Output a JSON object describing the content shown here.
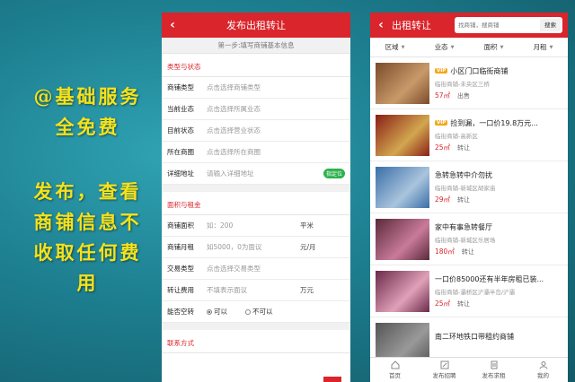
{
  "promo": {
    "lines": [
      "@基础服务",
      "全免费",
      "发布，查看",
      "商铺信息不",
      "收取任何费",
      "用"
    ]
  },
  "publish": {
    "title": "发布出租转让",
    "step": "第一步:填写商铺基本信息",
    "section1": "类型与状态",
    "fields1": [
      {
        "label": "商铺类型",
        "value": "点击选择商铺类型"
      },
      {
        "label": "当前业态",
        "value": "点击选择所属业态"
      },
      {
        "label": "目前状态",
        "value": "点击选择营业状态"
      },
      {
        "label": "所在商圈",
        "value": "点击选择所在商圈"
      },
      {
        "label": "详细地址",
        "value": "请输入详细地址"
      }
    ],
    "locate_label": "指定位",
    "section2": "面积与租金",
    "fields2": [
      {
        "label": "商铺面积",
        "value": "如：200",
        "unit": "平米"
      },
      {
        "label": "商铺月租",
        "value": "如5000，0为面议",
        "unit": "元/月"
      },
      {
        "label": "交易类型",
        "value": "点击选择交易类型",
        "unit": ""
      },
      {
        "label": "转让费用",
        "value": "不填表示面议",
        "unit": "万元"
      }
    ],
    "vacant_label": "能否空转",
    "vacant_yes": "可以",
    "vacant_no": "不可以",
    "section3": "联系方式"
  },
  "listing": {
    "title": "出租转让",
    "search_placeholder": "找商铺，搜商铺",
    "search_button": "搜索",
    "filters": [
      "区域",
      "业态",
      "面积",
      "月租"
    ],
    "items": [
      {
        "vip": true,
        "vip_label": "VIP",
        "title": "小区门口临街商铺",
        "location": "临街商铺-未央区三桥",
        "price": "57㎡",
        "type": "出售",
        "img": [
          "#7a4b2a",
          "#c89a6a"
        ]
      },
      {
        "vip": true,
        "vip_label": "VIP",
        "title": "捡到漏，一口价19.8万元...",
        "location": "临街商铺-高新区",
        "price": "25㎡",
        "type": "转让",
        "img": [
          "#8a1f16",
          "#d2a64f"
        ]
      },
      {
        "vip": false,
        "vip_label": "",
        "title": "急转急转中介勿扰",
        "location": "临街商铺-新城区胡家庙",
        "price": "29㎡",
        "type": "转让",
        "img": [
          "#3a6ea8",
          "#a9c4dd"
        ]
      },
      {
        "vip": false,
        "vip_label": "",
        "title": "家中有事急转餐厅",
        "location": "临街商铺-新城区乐居场",
        "price": "180㎡",
        "type": "转让",
        "img": [
          "#5a2a3a",
          "#c97a9a"
        ]
      },
      {
        "vip": false,
        "vip_label": "",
        "title": "一口价85000还有半年房租已装...",
        "location": "临街商铺-灞桥区浐灞半岛/浐灞",
        "price": "25㎡",
        "type": "转让",
        "img": [
          "#6a2a4a",
          "#e0a0b8"
        ]
      },
      {
        "vip": false,
        "vip_label": "",
        "title": "南二环地铁口带租约商铺",
        "location": "",
        "price": "",
        "type": "",
        "img": [
          "#555",
          "#999"
        ]
      }
    ],
    "nav": [
      {
        "label": "首页",
        "icon": "home-icon"
      },
      {
        "label": "发布招聘",
        "icon": "edit-icon"
      },
      {
        "label": "发布求租",
        "icon": "document-icon"
      },
      {
        "label": "我的",
        "icon": "user-icon"
      }
    ]
  },
  "colors": {
    "brand_red": "#d9252b",
    "promo_yellow": "#f6e21a",
    "locate_green": "#2bb24c",
    "vip_orange": "#f3a81b"
  }
}
